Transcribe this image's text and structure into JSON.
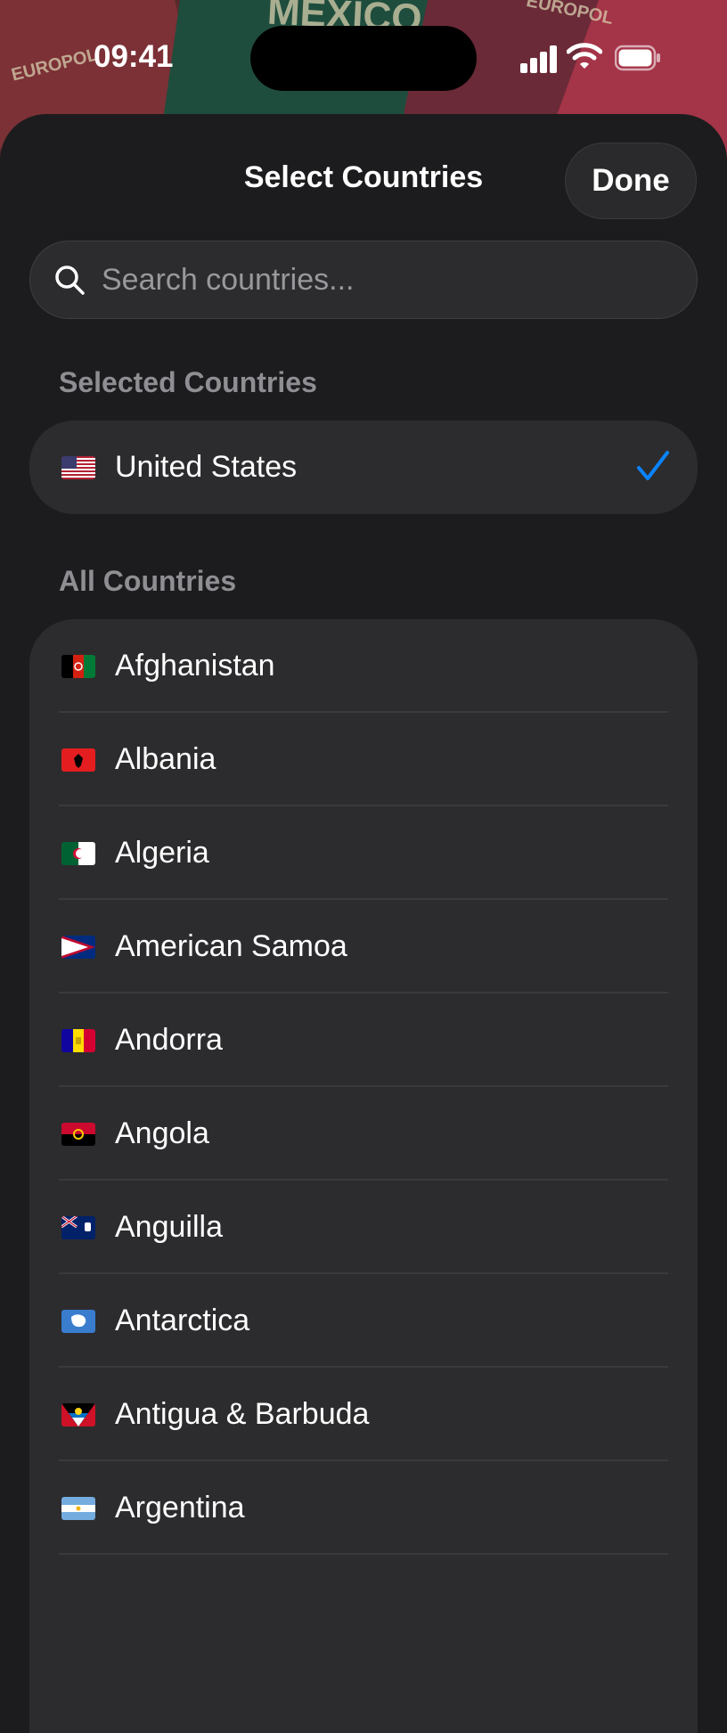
{
  "status_bar": {
    "time": "09:41"
  },
  "background": {
    "word_mexico": "MEXICO",
    "word_europol_left": "EUROPOL",
    "word_europol_right": "EUROPOL"
  },
  "header": {
    "title": "Select Countries",
    "done_label": "Done"
  },
  "search": {
    "placeholder": "Search countries...",
    "value": ""
  },
  "selected_section": {
    "title": "Selected Countries",
    "items": [
      {
        "name": "United States",
        "flag": "us-flag-icon",
        "checked": true
      }
    ]
  },
  "all_section": {
    "title": "All Countries",
    "items": [
      {
        "name": "Afghanistan",
        "flag": "afghanistan-flag-icon"
      },
      {
        "name": "Albania",
        "flag": "albania-flag-icon"
      },
      {
        "name": "Algeria",
        "flag": "algeria-flag-icon"
      },
      {
        "name": "American Samoa",
        "flag": "american-samoa-flag-icon"
      },
      {
        "name": "Andorra",
        "flag": "andorra-flag-icon"
      },
      {
        "name": "Angola",
        "flag": "angola-flag-icon"
      },
      {
        "name": "Anguilla",
        "flag": "anguilla-flag-icon"
      },
      {
        "name": "Antarctica",
        "flag": "antarctica-flag-icon"
      },
      {
        "name": "Antigua & Barbuda",
        "flag": "antigua-barbuda-flag-icon"
      },
      {
        "name": "Argentina",
        "flag": "argentina-flag-icon"
      }
    ]
  },
  "colors": {
    "background": "#1c1c1e",
    "card": "#2c2c2e",
    "accent_check": "#0a84ff",
    "section_header": "#8e8e93"
  }
}
